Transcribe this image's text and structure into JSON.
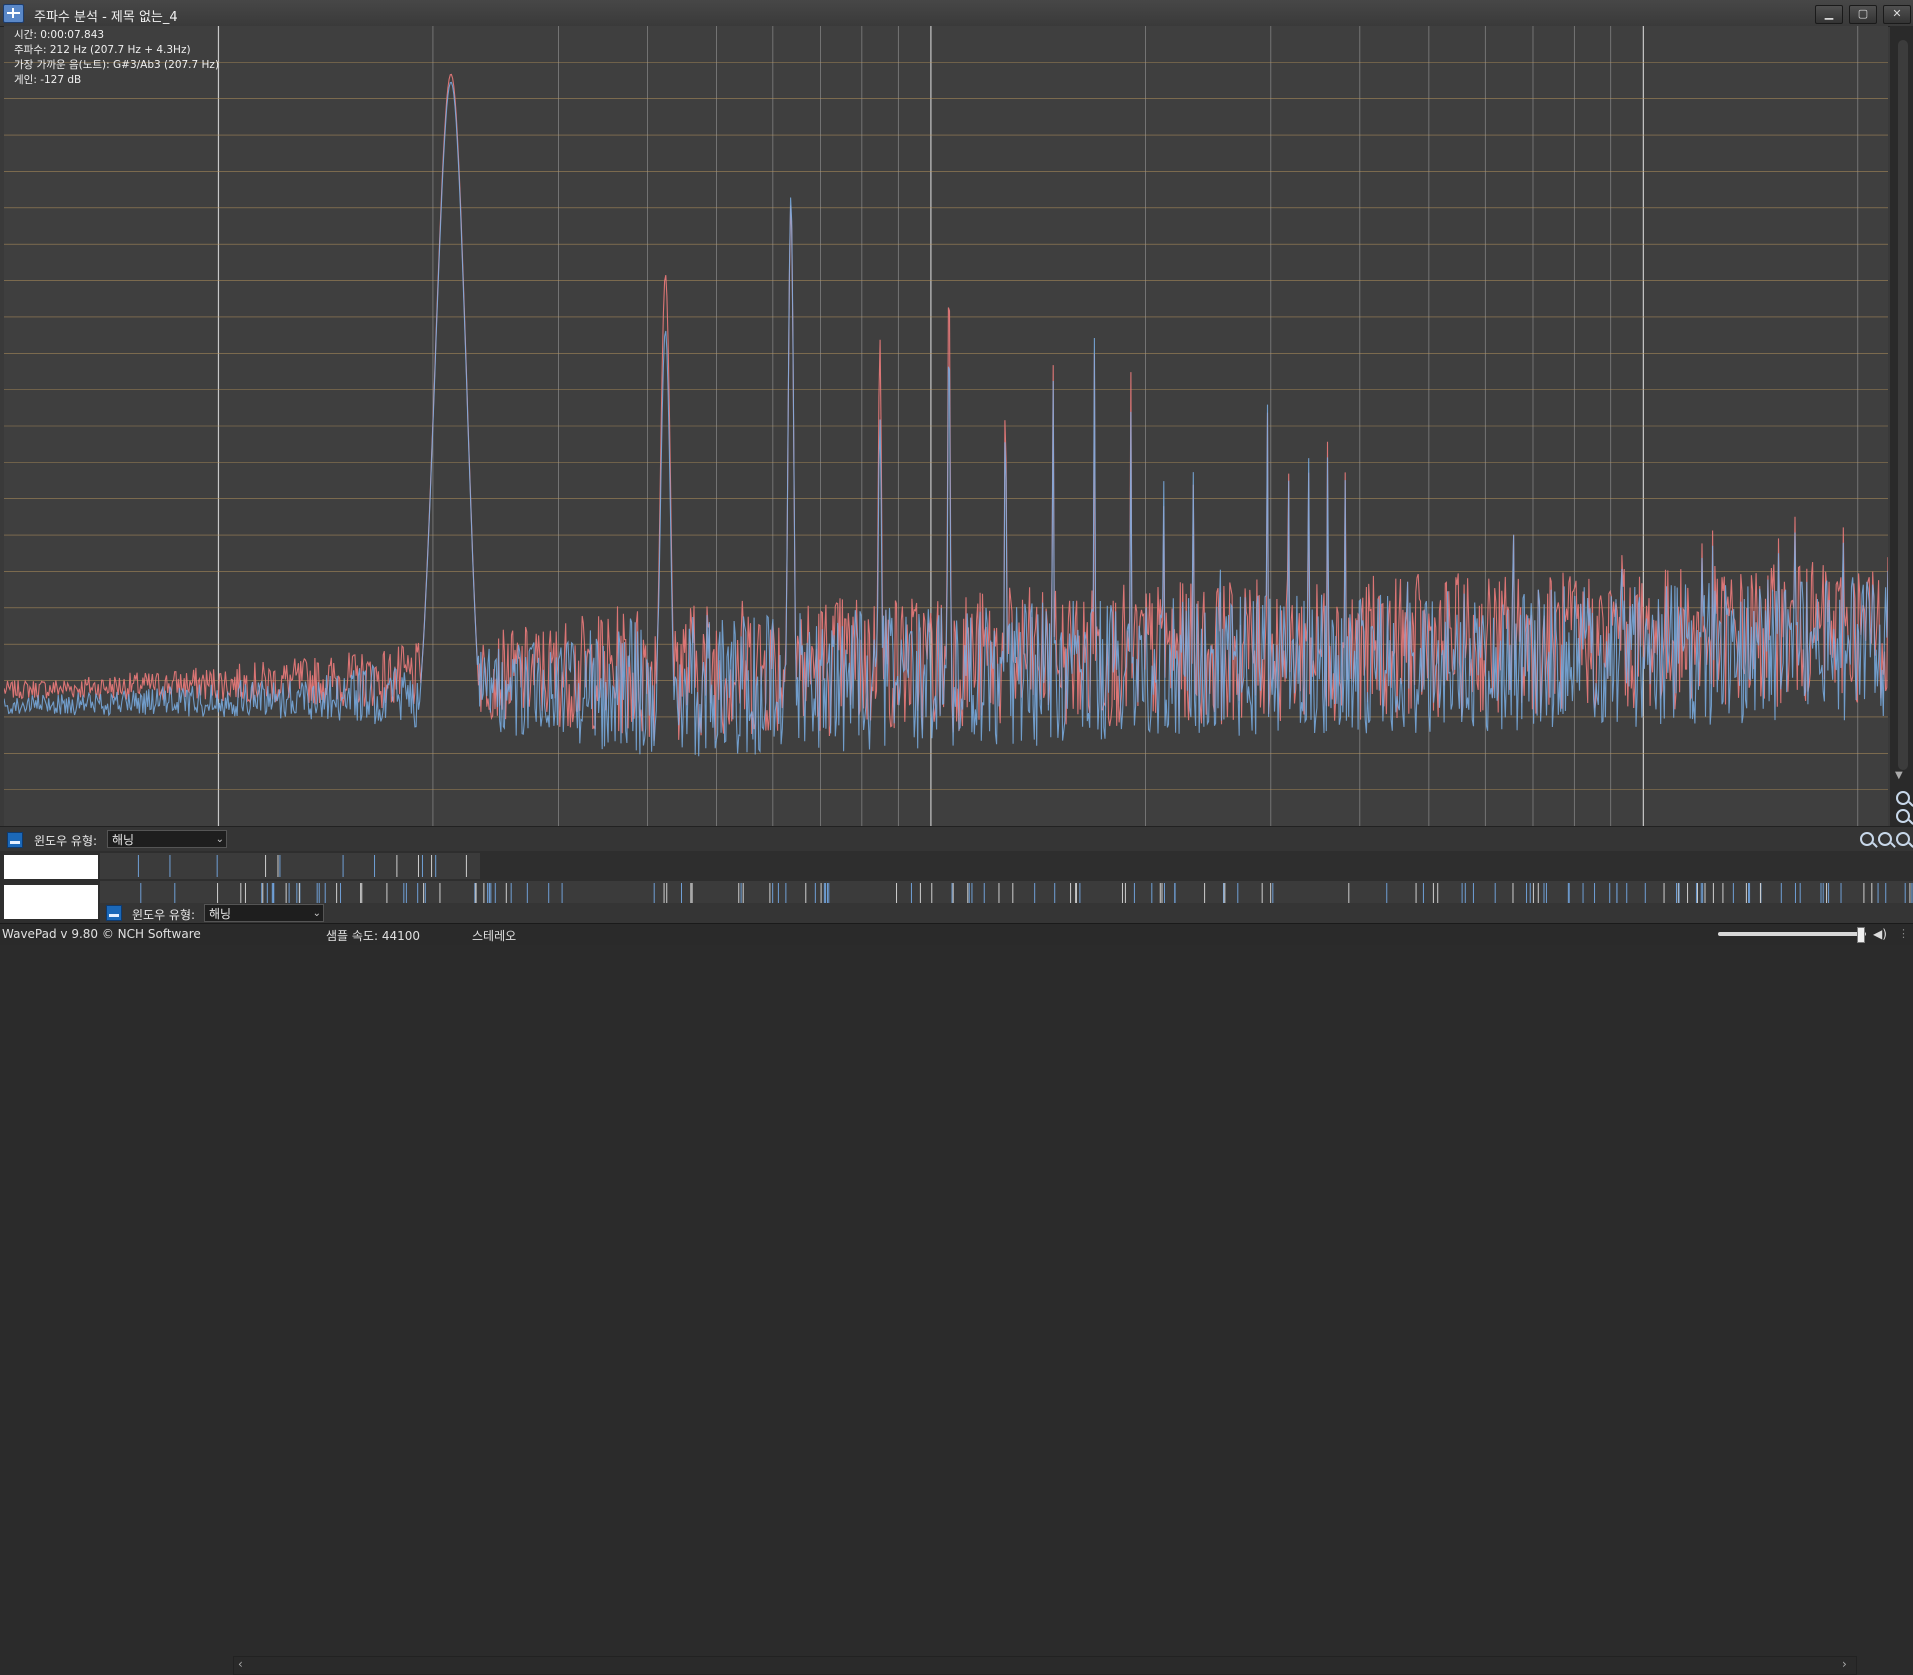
{
  "window": {
    "title": "주파수 분석 - 제목 없는_4",
    "controls": {
      "minimize": "▁",
      "maximize": "▢",
      "close": "✕"
    }
  },
  "readout": {
    "time": "시간: 0:00:07.843",
    "frequency": "주파수: 212 Hz (207.7 Hz + 4.3Hz)",
    "note": "가장 가까운 음(노트): G#3/Ab3 (207.7 Hz)",
    "gain": "게인: -127 dB"
  },
  "chart_data": {
    "type": "line",
    "title": "",
    "xlabel": "",
    "ylabel": "",
    "grid": true,
    "xscale": "log",
    "ylim": [
      0,
      100
    ],
    "series": [
      {
        "color": "#e47878",
        "peaks": [
          {
            "h": 1,
            "level": 94
          },
          {
            "h": 2,
            "level": 69
          },
          {
            "h": 3,
            "level": 78
          },
          {
            "h": 4,
            "level": 61
          },
          {
            "h": 5,
            "level": 70
          },
          {
            "h": 6,
            "level": 55
          },
          {
            "h": 7,
            "level": 58
          },
          {
            "h": 8,
            "level": 59
          },
          {
            "h": 9,
            "level": 57
          },
          {
            "h": 10,
            "level": 51
          },
          {
            "h": 11,
            "level": 54
          },
          {
            "h": 12,
            "level": 52
          },
          {
            "h": 13,
            "level": 54
          },
          {
            "h": 14,
            "level": 52
          },
          {
            "h": 15,
            "level": 50
          },
          {
            "h": 16,
            "level": 48
          },
          {
            "h": 17,
            "level": 49
          },
          {
            "h": 18,
            "level": 46
          }
        ],
        "noise_level": 17
      },
      {
        "color": "#7aaee4",
        "peaks": [
          {
            "h": 1,
            "level": 93
          },
          {
            "h": 2,
            "level": 62
          },
          {
            "h": 3,
            "level": 79
          },
          {
            "h": 4,
            "level": 51
          },
          {
            "h": 5,
            "level": 62
          },
          {
            "h": 6,
            "level": 52
          },
          {
            "h": 7,
            "level": 56
          },
          {
            "h": 8,
            "level": 61
          },
          {
            "h": 9,
            "level": 52
          },
          {
            "h": 10,
            "level": 55
          },
          {
            "h": 11,
            "level": 56
          },
          {
            "h": 12,
            "level": 57
          },
          {
            "h": 13,
            "level": 52
          },
          {
            "h": 14,
            "level": 53
          },
          {
            "h": 15,
            "level": 49
          },
          {
            "h": 16,
            "level": 50
          },
          {
            "h": 17,
            "level": 47
          },
          {
            "h": 18,
            "level": 45
          }
        ],
        "noise_level": 15
      }
    ]
  },
  "analysis_panel": {
    "window_type_label": "윈도우 유형:",
    "window_type_value": "해닝"
  },
  "mini_panel": {
    "window_type_label": "윈도우 유형:",
    "window_type_value": "해닝"
  },
  "statusbar": {
    "version": "WavePad v 9.80 © NCH Software",
    "sample_rate": "샘플 속도: 44100",
    "channels": "스테레오"
  }
}
